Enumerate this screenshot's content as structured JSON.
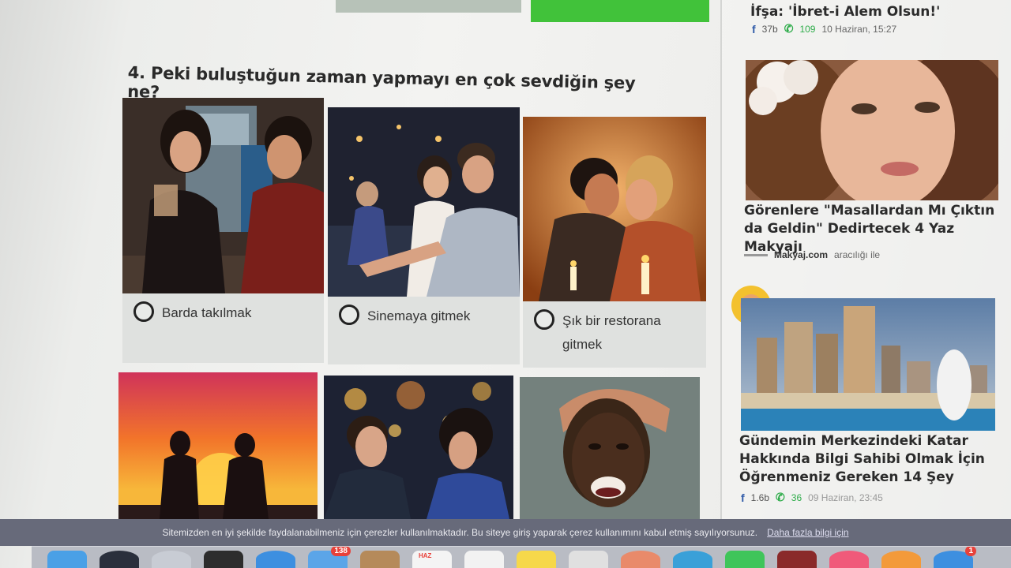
{
  "question": {
    "title": "4. Peki buluştuğun zaman yapmayı en çok sevdiğin şey ne?",
    "options": [
      {
        "label": "Barda takılmak",
        "image": "couple-at-bar"
      },
      {
        "label": "Sinemaya gitmek",
        "image": "couple-at-cinema"
      },
      {
        "label": "Şık bir restorana gitmek",
        "image": "couple-at-restaurant"
      },
      {
        "label": "",
        "image": "silhouettes-at-sunset"
      },
      {
        "label": "",
        "image": "couple-city-lights"
      },
      {
        "label": "",
        "image": "laughing-woman"
      }
    ]
  },
  "sidebar": {
    "top_item": {
      "headline": "İfşa: 'İbret-i Alem Olsun!'",
      "fb_count": "37b",
      "wa_count": "109",
      "date": "10 Haziran, 15:27"
    },
    "ad_item": {
      "headline": "Görenlere \"Masallardan Mı Çıktın da Geldin\" Dedirtecek 4 Yaz Makyajı",
      "sponsor": "Makyaj.com",
      "sponsor_suffix": "aracılığı ile"
    },
    "news_item": {
      "headline": "Gündemin Merkezindeki Katar Hakkında Bilgi Sahibi Olmak İçin Öğrenmeniz Gereken 14 Şey",
      "fb_count": "1.6b",
      "wa_count": "36",
      "date": "09 Haziran, 23:45",
      "reaction_icon": "clapping-hands-icon"
    }
  },
  "cookie_bar": {
    "text": "Sitemizden en iyi şekilde faydalanabilmeniz için çerezler kullanılmaktadır. Bu siteye giriş yaparak çerez kullanımını kabul etmiş sayılıyorsunuz.",
    "link": "Daha fazla bilgi için"
  },
  "dock": {
    "badges": [
      "138",
      "1"
    ],
    "calendar_month": "HAZ"
  },
  "colors": {
    "green_button": "#41c23a",
    "cookie_bar": "#676a7a",
    "facebook": "#2f5aa8",
    "whatsapp": "#2eac4a"
  }
}
